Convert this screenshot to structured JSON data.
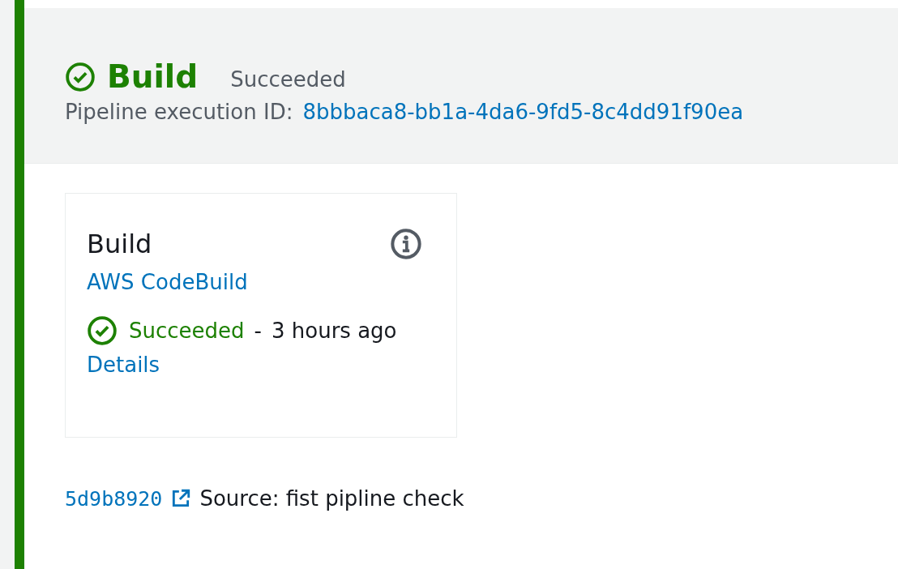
{
  "stage": {
    "title": "Build",
    "succeeded": true,
    "status_label": "Succeeded",
    "execution_id_label": "Pipeline execution ID:",
    "execution_id": "8bbbaca8-bb1a-4da6-9fd5-8c4dd91f90ea"
  },
  "action": {
    "title": "Build",
    "provider": "AWS CodeBuild",
    "succeeded": true,
    "status_label": "Succeeded",
    "separator": "-",
    "time": "3 hours ago",
    "details": "Details"
  },
  "revision": {
    "commit": "5d9b8920",
    "message": "Source: fist pipline check"
  }
}
